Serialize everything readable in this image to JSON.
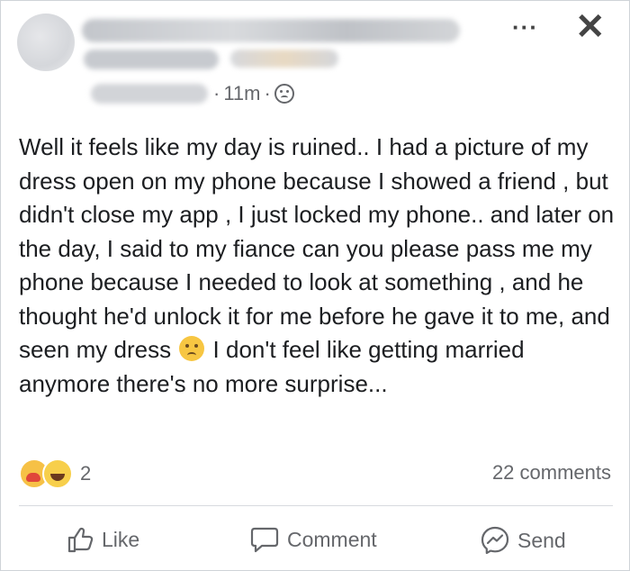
{
  "header": {
    "time": "11m",
    "separator": "·",
    "more_label": "···",
    "close_label": "✕"
  },
  "post": {
    "text_before_emoji": "Well it feels like my day is ruined.. I had a picture of my dress open on my phone because I showed a friend , but didn't close my app , I just locked my phone.. and later on the day,  I said to my fiance can you please pass me my phone because I needed to look at something , and he thought he'd unlock it for me before he gave it to me, and seen my dress",
    "emoji": "sad-relieved-face",
    "text_after_emoji": "I don't feel like getting married anymore there's no more surprise..."
  },
  "reactions": {
    "icons": [
      "care",
      "haha"
    ],
    "count": "2",
    "comments": "22 comments"
  },
  "actions": {
    "like": "Like",
    "comment": "Comment",
    "send": "Send"
  },
  "colors": {
    "text": "#1c1e21",
    "secondary": "#65676b",
    "divider": "#d8dadf"
  }
}
